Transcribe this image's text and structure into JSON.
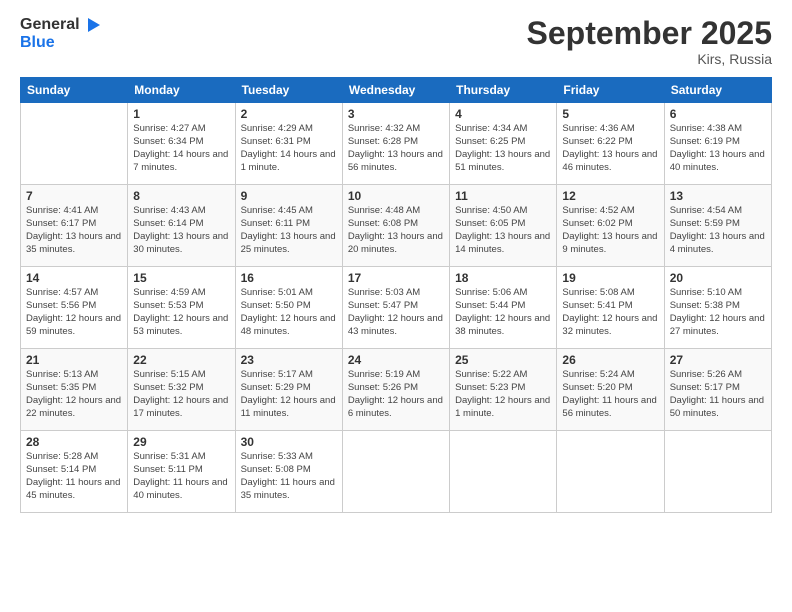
{
  "header": {
    "logo_line1": "General",
    "logo_line2": "Blue",
    "month": "September 2025",
    "location": "Kirs, Russia"
  },
  "weekdays": [
    "Sunday",
    "Monday",
    "Tuesday",
    "Wednesday",
    "Thursday",
    "Friday",
    "Saturday"
  ],
  "weeks": [
    [
      {
        "day": "",
        "sunrise": "",
        "sunset": "",
        "daylight": ""
      },
      {
        "day": "1",
        "sunrise": "Sunrise: 4:27 AM",
        "sunset": "Sunset: 6:34 PM",
        "daylight": "Daylight: 14 hours and 7 minutes."
      },
      {
        "day": "2",
        "sunrise": "Sunrise: 4:29 AM",
        "sunset": "Sunset: 6:31 PM",
        "daylight": "Daylight: 14 hours and 1 minute."
      },
      {
        "day": "3",
        "sunrise": "Sunrise: 4:32 AM",
        "sunset": "Sunset: 6:28 PM",
        "daylight": "Daylight: 13 hours and 56 minutes."
      },
      {
        "day": "4",
        "sunrise": "Sunrise: 4:34 AM",
        "sunset": "Sunset: 6:25 PM",
        "daylight": "Daylight: 13 hours and 51 minutes."
      },
      {
        "day": "5",
        "sunrise": "Sunrise: 4:36 AM",
        "sunset": "Sunset: 6:22 PM",
        "daylight": "Daylight: 13 hours and 46 minutes."
      },
      {
        "day": "6",
        "sunrise": "Sunrise: 4:38 AM",
        "sunset": "Sunset: 6:19 PM",
        "daylight": "Daylight: 13 hours and 40 minutes."
      }
    ],
    [
      {
        "day": "7",
        "sunrise": "Sunrise: 4:41 AM",
        "sunset": "Sunset: 6:17 PM",
        "daylight": "Daylight: 13 hours and 35 minutes."
      },
      {
        "day": "8",
        "sunrise": "Sunrise: 4:43 AM",
        "sunset": "Sunset: 6:14 PM",
        "daylight": "Daylight: 13 hours and 30 minutes."
      },
      {
        "day": "9",
        "sunrise": "Sunrise: 4:45 AM",
        "sunset": "Sunset: 6:11 PM",
        "daylight": "Daylight: 13 hours and 25 minutes."
      },
      {
        "day": "10",
        "sunrise": "Sunrise: 4:48 AM",
        "sunset": "Sunset: 6:08 PM",
        "daylight": "Daylight: 13 hours and 20 minutes."
      },
      {
        "day": "11",
        "sunrise": "Sunrise: 4:50 AM",
        "sunset": "Sunset: 6:05 PM",
        "daylight": "Daylight: 13 hours and 14 minutes."
      },
      {
        "day": "12",
        "sunrise": "Sunrise: 4:52 AM",
        "sunset": "Sunset: 6:02 PM",
        "daylight": "Daylight: 13 hours and 9 minutes."
      },
      {
        "day": "13",
        "sunrise": "Sunrise: 4:54 AM",
        "sunset": "Sunset: 5:59 PM",
        "daylight": "Daylight: 13 hours and 4 minutes."
      }
    ],
    [
      {
        "day": "14",
        "sunrise": "Sunrise: 4:57 AM",
        "sunset": "Sunset: 5:56 PM",
        "daylight": "Daylight: 12 hours and 59 minutes."
      },
      {
        "day": "15",
        "sunrise": "Sunrise: 4:59 AM",
        "sunset": "Sunset: 5:53 PM",
        "daylight": "Daylight: 12 hours and 53 minutes."
      },
      {
        "day": "16",
        "sunrise": "Sunrise: 5:01 AM",
        "sunset": "Sunset: 5:50 PM",
        "daylight": "Daylight: 12 hours and 48 minutes."
      },
      {
        "day": "17",
        "sunrise": "Sunrise: 5:03 AM",
        "sunset": "Sunset: 5:47 PM",
        "daylight": "Daylight: 12 hours and 43 minutes."
      },
      {
        "day": "18",
        "sunrise": "Sunrise: 5:06 AM",
        "sunset": "Sunset: 5:44 PM",
        "daylight": "Daylight: 12 hours and 38 minutes."
      },
      {
        "day": "19",
        "sunrise": "Sunrise: 5:08 AM",
        "sunset": "Sunset: 5:41 PM",
        "daylight": "Daylight: 12 hours and 32 minutes."
      },
      {
        "day": "20",
        "sunrise": "Sunrise: 5:10 AM",
        "sunset": "Sunset: 5:38 PM",
        "daylight": "Daylight: 12 hours and 27 minutes."
      }
    ],
    [
      {
        "day": "21",
        "sunrise": "Sunrise: 5:13 AM",
        "sunset": "Sunset: 5:35 PM",
        "daylight": "Daylight: 12 hours and 22 minutes."
      },
      {
        "day": "22",
        "sunrise": "Sunrise: 5:15 AM",
        "sunset": "Sunset: 5:32 PM",
        "daylight": "Daylight: 12 hours and 17 minutes."
      },
      {
        "day": "23",
        "sunrise": "Sunrise: 5:17 AM",
        "sunset": "Sunset: 5:29 PM",
        "daylight": "Daylight: 12 hours and 11 minutes."
      },
      {
        "day": "24",
        "sunrise": "Sunrise: 5:19 AM",
        "sunset": "Sunset: 5:26 PM",
        "daylight": "Daylight: 12 hours and 6 minutes."
      },
      {
        "day": "25",
        "sunrise": "Sunrise: 5:22 AM",
        "sunset": "Sunset: 5:23 PM",
        "daylight": "Daylight: 12 hours and 1 minute."
      },
      {
        "day": "26",
        "sunrise": "Sunrise: 5:24 AM",
        "sunset": "Sunset: 5:20 PM",
        "daylight": "Daylight: 11 hours and 56 minutes."
      },
      {
        "day": "27",
        "sunrise": "Sunrise: 5:26 AM",
        "sunset": "Sunset: 5:17 PM",
        "daylight": "Daylight: 11 hours and 50 minutes."
      }
    ],
    [
      {
        "day": "28",
        "sunrise": "Sunrise: 5:28 AM",
        "sunset": "Sunset: 5:14 PM",
        "daylight": "Daylight: 11 hours and 45 minutes."
      },
      {
        "day": "29",
        "sunrise": "Sunrise: 5:31 AM",
        "sunset": "Sunset: 5:11 PM",
        "daylight": "Daylight: 11 hours and 40 minutes."
      },
      {
        "day": "30",
        "sunrise": "Sunrise: 5:33 AM",
        "sunset": "Sunset: 5:08 PM",
        "daylight": "Daylight: 11 hours and 35 minutes."
      },
      {
        "day": "",
        "sunrise": "",
        "sunset": "",
        "daylight": ""
      },
      {
        "day": "",
        "sunrise": "",
        "sunset": "",
        "daylight": ""
      },
      {
        "day": "",
        "sunrise": "",
        "sunset": "",
        "daylight": ""
      },
      {
        "day": "",
        "sunrise": "",
        "sunset": "",
        "daylight": ""
      }
    ]
  ]
}
